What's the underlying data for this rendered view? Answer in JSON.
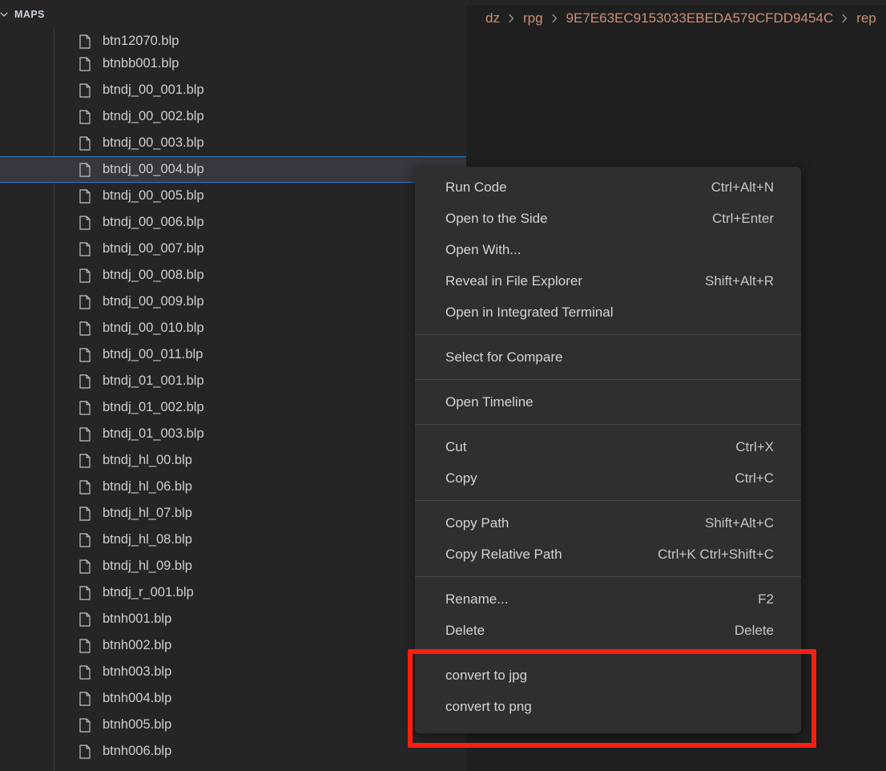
{
  "window": {
    "background": "#1f1f1f",
    "accent": "#2f7cd4",
    "annotation_color": "#fb1f10"
  },
  "sidebar": {
    "section": {
      "title": "MAPS",
      "chevron_icon": "chevron-down-icon",
      "expanded": true
    },
    "file_icon": "file-icon",
    "selected_file": "btndj_00_004.blp",
    "files": [
      "btn12070.blp",
      "btnbb001.blp",
      "btndj_00_001.blp",
      "btndj_00_002.blp",
      "btndj_00_003.blp",
      "btndj_00_004.blp",
      "btndj_00_005.blp",
      "btndj_00_006.blp",
      "btndj_00_007.blp",
      "btndj_00_008.blp",
      "btndj_00_009.blp",
      "btndj_00_010.blp",
      "btndj_00_011.blp",
      "btndj_01_001.blp",
      "btndj_01_002.blp",
      "btndj_01_003.blp",
      "btndj_hl_00.blp",
      "btndj_hl_06.blp",
      "btndj_hl_07.blp",
      "btndj_hl_08.blp",
      "btndj_hl_09.blp",
      "btndj_r_001.blp",
      "btnh001.blp",
      "btnh002.blp",
      "btnh003.blp",
      "btnh004.blp",
      "btnh005.blp",
      "btnh006.blp"
    ]
  },
  "editor": {
    "breadcrumb": {
      "separator_icon": "chevron-right-icon",
      "items": [
        "dz",
        "rpg",
        "9E7E63EC9153033EBEDA579CFDD9454C",
        "rep"
      ]
    }
  },
  "context_menu": {
    "groups": [
      {
        "items": [
          {
            "label": "Run Code",
            "shortcut": "Ctrl+Alt+N"
          },
          {
            "label": "Open to the Side",
            "shortcut": "Ctrl+Enter"
          },
          {
            "label": "Open With...",
            "shortcut": ""
          },
          {
            "label": "Reveal in File Explorer",
            "shortcut": "Shift+Alt+R"
          },
          {
            "label": "Open in Integrated Terminal",
            "shortcut": ""
          }
        ]
      },
      {
        "items": [
          {
            "label": "Select for Compare",
            "shortcut": ""
          }
        ]
      },
      {
        "items": [
          {
            "label": "Open Timeline",
            "shortcut": ""
          }
        ]
      },
      {
        "items": [
          {
            "label": "Cut",
            "shortcut": "Ctrl+X"
          },
          {
            "label": "Copy",
            "shortcut": "Ctrl+C"
          }
        ]
      },
      {
        "items": [
          {
            "label": "Copy Path",
            "shortcut": "Shift+Alt+C"
          },
          {
            "label": "Copy Relative Path",
            "shortcut": "Ctrl+K Ctrl+Shift+C"
          }
        ]
      },
      {
        "items": [
          {
            "label": "Rename...",
            "shortcut": "F2"
          },
          {
            "label": "Delete",
            "shortcut": "Delete"
          }
        ]
      },
      {
        "items": [
          {
            "label": "convert to jpg",
            "shortcut": ""
          },
          {
            "label": "convert to png",
            "shortcut": ""
          }
        ]
      }
    ]
  },
  "annotation": {
    "type": "red-rectangle-highlight",
    "targets": [
      "convert to jpg",
      "convert to png"
    ]
  }
}
